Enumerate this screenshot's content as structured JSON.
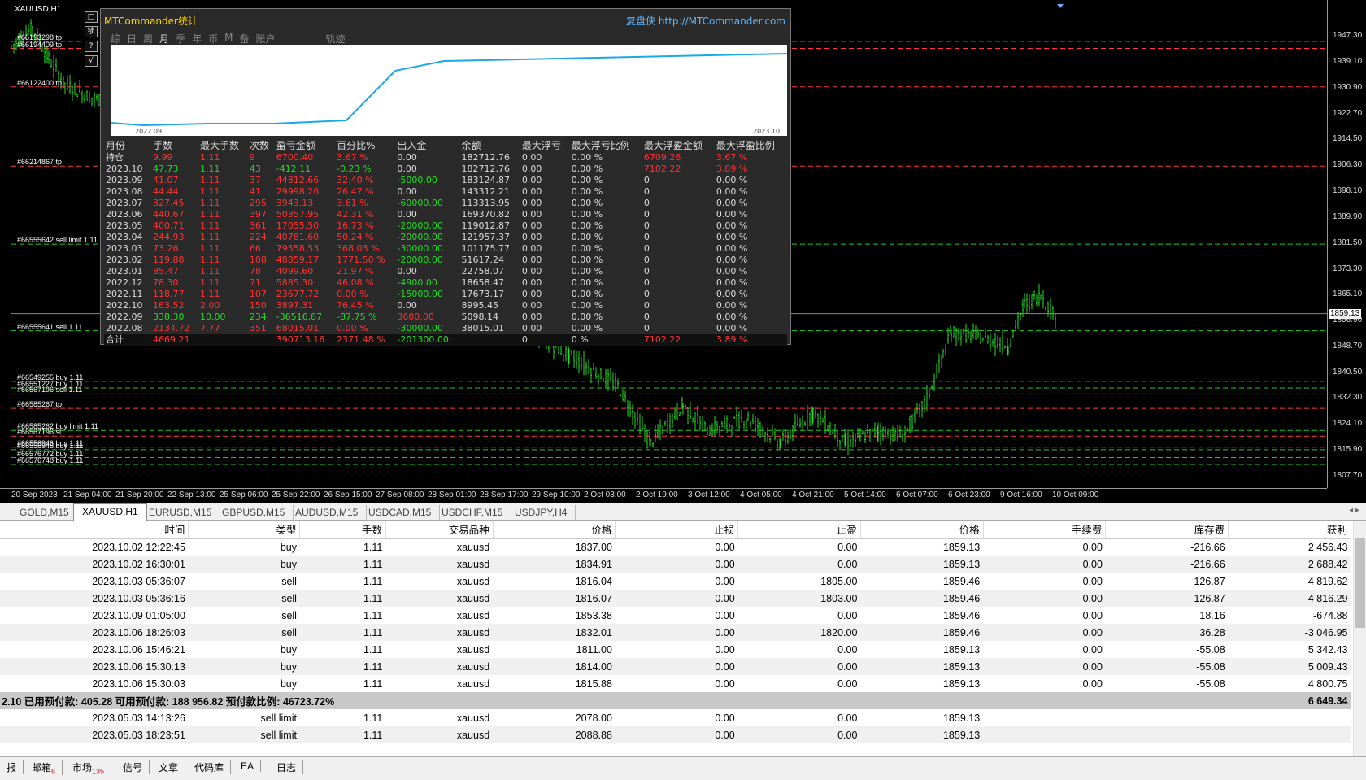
{
  "chart": {
    "symbol": "XAUUSD,H1",
    "current_price": "1859.13",
    "price_ticks": [
      "1947.30",
      "1939.10",
      "1930.90",
      "1922.70",
      "1914.50",
      "1906.30",
      "1898.10",
      "1889.90",
      "1881.50",
      "1873.30",
      "1865.10",
      "1856.90",
      "1848.70",
      "1840.50",
      "1832.30",
      "1824.10",
      "1815.90",
      "1807.70"
    ],
    "time_ticks": [
      "20 Sep 2023",
      "21 Sep 04:00",
      "21 Sep 20:00",
      "22 Sep 13:00",
      "25 Sep 06:00",
      "25 Sep 22:00",
      "26 Sep 15:00",
      "27 Sep 08:00",
      "28 Sep 01:00",
      "28 Sep 17:00",
      "29 Sep 10:00",
      "2 Oct 03:00",
      "2 Oct 19:00",
      "3 Oct 12:00",
      "4 Oct 05:00",
      "4 Oct 21:00",
      "5 Oct 14:00",
      "6 Oct 07:00",
      "6 Oct 23:00",
      "9 Oct 16:00",
      "10 Oct 09:00"
    ],
    "orders": [
      {
        "label": "#66193298 tp",
        "color": "#ff3b3b"
      },
      {
        "label": "#66194409 tp",
        "color": "#ff3b3b"
      },
      {
        "label": "#66122400 tp",
        "color": "#ff3b3b"
      },
      {
        "label": "#66214867 tp",
        "color": "#ff3b3b"
      },
      {
        "label": "#66555642 sell limit 1.11",
        "color": "#22cc22"
      },
      {
        "label": "#66555641 sell 1.11",
        "color": "#22cc22"
      },
      {
        "label": "#66549255 buy 1.11",
        "color": "#22cc22"
      },
      {
        "label": "#66551227 buy 1.11",
        "color": "#22cc22"
      },
      {
        "label": "#66567196 sell 1.11",
        "color": "#22cc22"
      },
      {
        "label": "#66585267 tp",
        "color": "#ff3b3b"
      },
      {
        "label": "#66585262 buy limit 1.11",
        "color": "#22cc22"
      },
      {
        "label": "#66567196 sl",
        "color": "#ff3b3b"
      },
      {
        "label": "#66556946 buy 1.11",
        "color": "#22cc22"
      },
      {
        "label": "#66556948 buy 1.11",
        "color": "#22cc22"
      },
      {
        "label": "#66576772 buy 1.11",
        "color": "#22cc22"
      },
      {
        "label": "#66576748 buy 1.11",
        "color": "#22cc22"
      }
    ],
    "side_buttons": [
      "□",
      "锁",
      "?",
      "√"
    ]
  },
  "stats": {
    "title": "MTCommander统计",
    "brand": "复盘侠 http://MTCommander.com",
    "tabs": [
      "综",
      "日",
      "周",
      "月",
      "季",
      "年",
      "币",
      "M",
      "备",
      "账户",
      "轨迹"
    ],
    "mini_x_labels": [
      "2022.09",
      "2023.10"
    ],
    "headers": [
      "月份",
      "手数",
      "最大手数",
      "次数",
      "盈亏金额",
      "百分比%",
      "出入金",
      "余额",
      "最大浮亏",
      "最大浮亏比例",
      "最大浮盈金额",
      "最大浮盈比例"
    ],
    "rows": [
      [
        "持仓",
        "9.99",
        "1.11",
        "9",
        "6700.40",
        "3.67 %",
        "0.00",
        "182712.76",
        "0.00",
        "0.00 %",
        "6709.26",
        "3.67 %"
      ],
      [
        "2023.10",
        "47.73",
        "1.11",
        "43",
        "-412.11",
        "-0.23 %",
        "0.00",
        "182712.76",
        "0.00",
        "0.00 %",
        "7102.22",
        "3.89 %"
      ],
      [
        "2023.09",
        "41.07",
        "1.11",
        "37",
        "44812.66",
        "32.40 %",
        "-5000.00",
        "183124.87",
        "0.00",
        "0.00 %",
        "0",
        "0.00 %"
      ],
      [
        "2023.08",
        "44.44",
        "1.11",
        "41",
        "29998.26",
        "26.47 %",
        "0.00",
        "143312.21",
        "0.00",
        "0.00 %",
        "0",
        "0.00 %"
      ],
      [
        "2023.07",
        "327.45",
        "1.11",
        "295",
        "3943.13",
        "3.61 %",
        "-60000.00",
        "113313.95",
        "0.00",
        "0.00 %",
        "0",
        "0.00 %"
      ],
      [
        "2023.06",
        "440.67",
        "1.11",
        "397",
        "50357.95",
        "42.31 %",
        "0.00",
        "169370.82",
        "0.00",
        "0.00 %",
        "0",
        "0.00 %"
      ],
      [
        "2023.05",
        "400.71",
        "1.11",
        "361",
        "17055.50",
        "16.73 %",
        "-20000.00",
        "119012.87",
        "0.00",
        "0.00 %",
        "0",
        "0.00 %"
      ],
      [
        "2023.04",
        "244.93",
        "1.11",
        "224",
        "40781.60",
        "50.24 %",
        "-20000.00",
        "121957.37",
        "0.00",
        "0.00 %",
        "0",
        "0.00 %"
      ],
      [
        "2023.03",
        "73.26",
        "1.11",
        "66",
        "79558.53",
        "368.03 %",
        "-30000.00",
        "101175.77",
        "0.00",
        "0.00 %",
        "0",
        "0.00 %"
      ],
      [
        "2023.02",
        "119.88",
        "1.11",
        "108",
        "48859.17",
        "1771.50 %",
        "-20000.00",
        "51617.24",
        "0.00",
        "0.00 %",
        "0",
        "0.00 %"
      ],
      [
        "2023.01",
        "85.47",
        "1.11",
        "78",
        "4099.60",
        "21.97 %",
        "0.00",
        "22758.07",
        "0.00",
        "0.00 %",
        "0",
        "0.00 %"
      ],
      [
        "2022.12",
        "78.30",
        "1.11",
        "71",
        "5885.30",
        "46.08 %",
        "-4900.00",
        "18658.47",
        "0.00",
        "0.00 %",
        "0",
        "0.00 %"
      ],
      [
        "2022.11",
        "118.77",
        "1.11",
        "107",
        "23677.72",
        "0.00 %",
        "-15000.00",
        "17673.17",
        "0.00",
        "0.00 %",
        "0",
        "0.00 %"
      ],
      [
        "2022.10",
        "163.52",
        "2.00",
        "150",
        "3897.31",
        "76.45 %",
        "0.00",
        "8995.45",
        "0.00",
        "0.00 %",
        "0",
        "0.00 %"
      ],
      [
        "2022.09",
        "338.30",
        "10.00",
        "234",
        "-36516.87",
        "-87.75 %",
        "3600.00",
        "5098.14",
        "0.00",
        "0.00 %",
        "0",
        "0.00 %"
      ],
      [
        "2022.08",
        "2134.72",
        "7.77",
        "351",
        "68015.01",
        "0.00 %",
        "-30000.00",
        "38015.01",
        "0.00",
        "0.00 %",
        "0",
        "0.00 %"
      ]
    ],
    "total": [
      "合计",
      "4669.21",
      "",
      "",
      "390713.16",
      "2371.48 %",
      "-201300.00",
      "",
      "0",
      "0 %",
      "7102.22",
      "3.89 %"
    ]
  },
  "symbol_tabs": [
    "GOLD,M15",
    "XAUUSD,H1",
    "EURUSD,M15",
    "GBPUSD,M15",
    "AUDUSD,M15",
    "USDCAD,M15",
    "USDCHF,M15",
    "USDJPY,H4"
  ],
  "active_tab": "XAUUSD,H1",
  "terminal": {
    "headers": [
      "时间",
      "类型",
      "手数",
      "交易品种",
      "价格",
      "止损",
      "止盈",
      "价格",
      "手续费",
      "库存费",
      "获利"
    ],
    "rows": [
      [
        "2023.10.02 12:22:45",
        "buy",
        "1.11",
        "xauusd",
        "1837.00",
        "0.00",
        "0.00",
        "1859.13",
        "0.00",
        "-216.66",
        "2 456.43"
      ],
      [
        "2023.10.02 16:30:01",
        "buy",
        "1.11",
        "xauusd",
        "1834.91",
        "0.00",
        "0.00",
        "1859.13",
        "0.00",
        "-216.66",
        "2 688.42"
      ],
      [
        "2023.10.03 05:36:07",
        "sell",
        "1.11",
        "xauusd",
        "1816.04",
        "0.00",
        "1805.00",
        "1859.46",
        "0.00",
        "126.87",
        "-4 819.62"
      ],
      [
        "2023.10.03 05:36:16",
        "sell",
        "1.11",
        "xauusd",
        "1816.07",
        "0.00",
        "1803.00",
        "1859.46",
        "0.00",
        "126.87",
        "-4 816.29"
      ],
      [
        "2023.10.09 01:05:00",
        "sell",
        "1.11",
        "xauusd",
        "1853.38",
        "0.00",
        "0.00",
        "1859.46",
        "0.00",
        "18.16",
        "-674.88"
      ],
      [
        "2023.10.06 18:26:03",
        "sell",
        "1.11",
        "xauusd",
        "1832.01",
        "0.00",
        "1820.00",
        "1859.46",
        "0.00",
        "36.28",
        "-3 046.95"
      ],
      [
        "2023.10.06 15:46:21",
        "buy",
        "1.11",
        "xauusd",
        "1811.00",
        "0.00",
        "0.00",
        "1859.13",
        "0.00",
        "-55.08",
        "5 342.43"
      ],
      [
        "2023.10.06 15:30:13",
        "buy",
        "1.11",
        "xauusd",
        "1814.00",
        "0.00",
        "0.00",
        "1859.13",
        "0.00",
        "-55.08",
        "5 009.43"
      ],
      [
        "2023.10.06 15:30:03",
        "buy",
        "1.11",
        "xauusd",
        "1815.88",
        "0.00",
        "0.00",
        "1859.13",
        "0.00",
        "-55.08",
        "4 800.75"
      ]
    ],
    "summary_left": "2.10  已用预付款: 405.28  可用预付款: 188 956.82  预付款比例: 46723.72%",
    "summary_right": "6 649.34",
    "pending": [
      [
        "2023.05.03 14:13:26",
        "sell limit",
        "1.11",
        "xauusd",
        "2078.00",
        "0.00",
        "0.00",
        "1859.13"
      ],
      [
        "2023.05.03 18:23:51",
        "sell limit",
        "1.11",
        "xauusd",
        "2088.88",
        "0.00",
        "0.00",
        "1859.13"
      ]
    ]
  },
  "bottom_tabs": [
    {
      "label": "报",
      "badge": ""
    },
    {
      "label": "邮箱",
      "badge": "6"
    },
    {
      "label": "市场",
      "badge": "135"
    },
    {
      "label": "信号",
      "badge": ""
    },
    {
      "label": "文章",
      "badge": ""
    },
    {
      "label": "代码库",
      "badge": ""
    },
    {
      "label": "EA",
      "badge": ""
    },
    {
      "label": "日志",
      "badge": ""
    }
  ],
  "colors": {
    "profit": "#22dd22",
    "loss": "#ff3333",
    "header": "#dddddd",
    "mini_line": "#1ea7e6"
  }
}
